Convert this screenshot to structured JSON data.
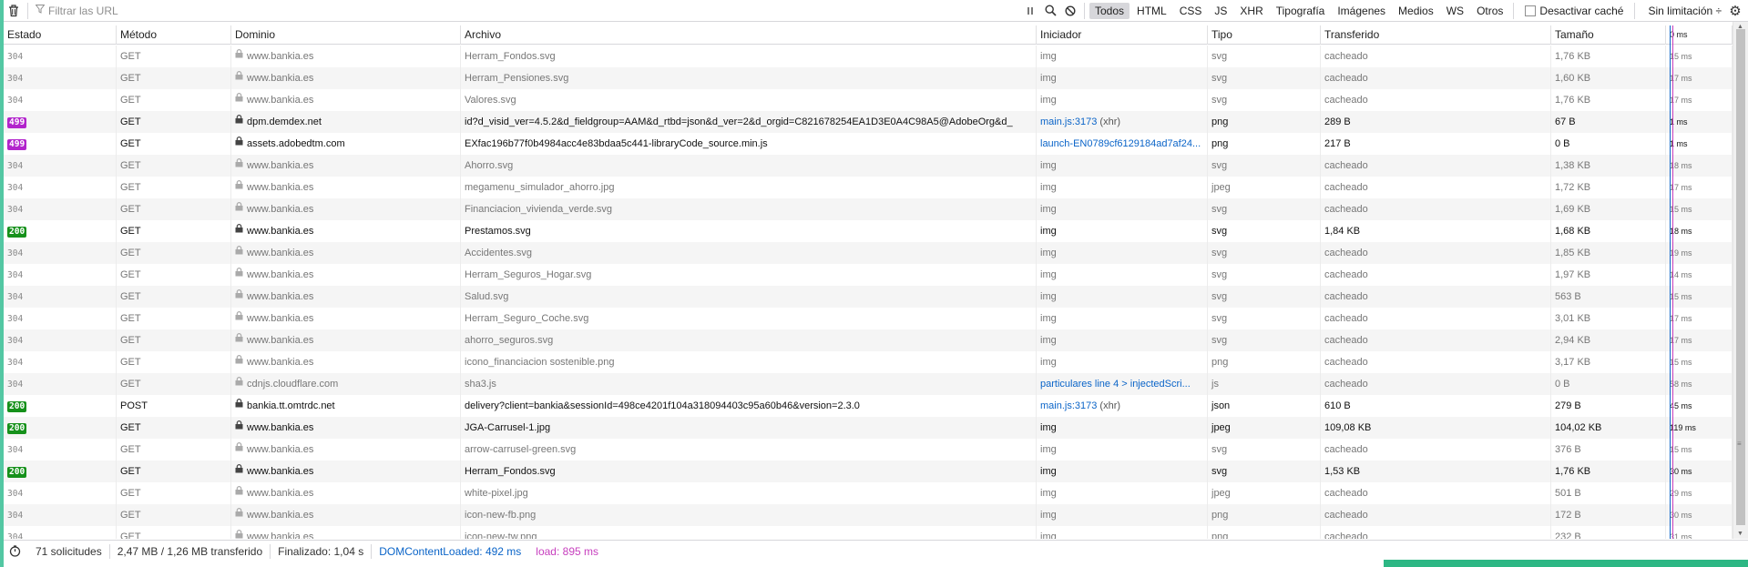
{
  "toolbar": {
    "filter_placeholder": "Filtrar las URL",
    "types": [
      "Todos",
      "HTML",
      "CSS",
      "JS",
      "XHR",
      "Tipografía",
      "Imágenes",
      "Medios",
      "WS",
      "Otros"
    ],
    "active_type": "Todos",
    "disable_cache_label": "Desactivar caché",
    "throttle_label": "Sin limitación ÷"
  },
  "columns": [
    "Estado",
    "Método",
    "Dominio",
    "Archivo",
    "Iniciador",
    "Tipo",
    "Transferido",
    "Tamaño",
    "0 ms"
  ],
  "colors": {
    "badge_200": "#16911b",
    "badge_499": "#b224cc",
    "accent": "#53c7a3",
    "link": "#0a64c8",
    "load": "#c73fbe"
  },
  "requests": [
    {
      "status": "304",
      "method": "GET",
      "domain": "www.bankia.es",
      "file": "Herram_Fondos.svg",
      "initiator": "img",
      "initiator_suffix": "",
      "type": "svg",
      "transferred": "cacheado",
      "size": "1,76 KB",
      "time": "15 ms",
      "fresh": false
    },
    {
      "status": "304",
      "method": "GET",
      "domain": "www.bankia.es",
      "file": "Herram_Pensiones.svg",
      "initiator": "img",
      "initiator_suffix": "",
      "type": "svg",
      "transferred": "cacheado",
      "size": "1,60 KB",
      "time": "17 ms",
      "fresh": false
    },
    {
      "status": "304",
      "method": "GET",
      "domain": "www.bankia.es",
      "file": "Valores.svg",
      "initiator": "img",
      "initiator_suffix": "",
      "type": "svg",
      "transferred": "cacheado",
      "size": "1,76 KB",
      "time": "17 ms",
      "fresh": false
    },
    {
      "status": "499",
      "method": "GET",
      "domain": "dpm.demdex.net",
      "file": "id?d_visid_ver=4.5.2&d_fieldgroup=AAM&d_rtbd=json&d_ver=2&d_orgid=C821678254EA1D3E0A4C98A5@AdobeOrg&d_",
      "initiator": "main.js:3173",
      "initiator_suffix": " (xhr)",
      "type": "png",
      "transferred": "289 B",
      "size": "67 B",
      "time": "1 ms",
      "fresh": true
    },
    {
      "status": "499",
      "method": "GET",
      "domain": "assets.adobedtm.com",
      "file": "EXfac196b77f0b4984acc4e83bdaa5c441-libraryCode_source.min.js",
      "initiator": "launch-EN0789cf6129184ad7af24...",
      "initiator_suffix": "",
      "type": "png",
      "transferred": "217 B",
      "size": "0 B",
      "time": "1 ms",
      "fresh": true
    },
    {
      "status": "304",
      "method": "GET",
      "domain": "www.bankia.es",
      "file": "Ahorro.svg",
      "initiator": "img",
      "initiator_suffix": "",
      "type": "svg",
      "transferred": "cacheado",
      "size": "1,38 KB",
      "time": "18 ms",
      "fresh": false
    },
    {
      "status": "304",
      "method": "GET",
      "domain": "www.bankia.es",
      "file": "megamenu_simulador_ahorro.jpg",
      "initiator": "img",
      "initiator_suffix": "",
      "type": "jpeg",
      "transferred": "cacheado",
      "size": "1,72 KB",
      "time": "17 ms",
      "fresh": false
    },
    {
      "status": "304",
      "method": "GET",
      "domain": "www.bankia.es",
      "file": "Financiacion_vivienda_verde.svg",
      "initiator": "img",
      "initiator_suffix": "",
      "type": "svg",
      "transferred": "cacheado",
      "size": "1,69 KB",
      "time": "15 ms",
      "fresh": false
    },
    {
      "status": "200",
      "method": "GET",
      "domain": "www.bankia.es",
      "file": "Prestamos.svg",
      "initiator": "img",
      "initiator_suffix": "",
      "type": "svg",
      "transferred": "1,84 KB",
      "size": "1,68 KB",
      "time": "18 ms",
      "fresh": true
    },
    {
      "status": "304",
      "method": "GET",
      "domain": "www.bankia.es",
      "file": "Accidentes.svg",
      "initiator": "img",
      "initiator_suffix": "",
      "type": "svg",
      "transferred": "cacheado",
      "size": "1,85 KB",
      "time": "19 ms",
      "fresh": false
    },
    {
      "status": "304",
      "method": "GET",
      "domain": "www.bankia.es",
      "file": "Herram_Seguros_Hogar.svg",
      "initiator": "img",
      "initiator_suffix": "",
      "type": "svg",
      "transferred": "cacheado",
      "size": "1,97 KB",
      "time": "14 ms",
      "fresh": false
    },
    {
      "status": "304",
      "method": "GET",
      "domain": "www.bankia.es",
      "file": "Salud.svg",
      "initiator": "img",
      "initiator_suffix": "",
      "type": "svg",
      "transferred": "cacheado",
      "size": "563 B",
      "time": "15 ms",
      "fresh": false
    },
    {
      "status": "304",
      "method": "GET",
      "domain": "www.bankia.es",
      "file": "Herram_Seguro_Coche.svg",
      "initiator": "img",
      "initiator_suffix": "",
      "type": "svg",
      "transferred": "cacheado",
      "size": "3,01 KB",
      "time": "17 ms",
      "fresh": false
    },
    {
      "status": "304",
      "method": "GET",
      "domain": "www.bankia.es",
      "file": "ahorro_seguros.svg",
      "initiator": "img",
      "initiator_suffix": "",
      "type": "svg",
      "transferred": "cacheado",
      "size": "2,94 KB",
      "time": "17 ms",
      "fresh": false
    },
    {
      "status": "304",
      "method": "GET",
      "domain": "www.bankia.es",
      "file": "icono_financiacion sostenible.png",
      "initiator": "img",
      "initiator_suffix": "",
      "type": "png",
      "transferred": "cacheado",
      "size": "3,17 KB",
      "time": "15 ms",
      "fresh": false
    },
    {
      "status": "304",
      "method": "GET",
      "domain": "cdnjs.cloudflare.com",
      "file": "sha3.js",
      "initiator": "particulares line 4 > injectedScri...",
      "initiator_suffix": "",
      "type": "js",
      "transferred": "cacheado",
      "size": "0 B",
      "time": "58 ms",
      "fresh": false
    },
    {
      "status": "200",
      "method": "POST",
      "domain": "bankia.tt.omtrdc.net",
      "file": "delivery?client=bankia&sessionId=498ce4201f104a318094403c95a60b46&version=2.3.0",
      "initiator": "main.js:3173",
      "initiator_suffix": " (xhr)",
      "type": "json",
      "transferred": "610 B",
      "size": "279 B",
      "time": "45 ms",
      "fresh": true
    },
    {
      "status": "200",
      "method": "GET",
      "domain": "www.bankia.es",
      "file": "JGA-Carrusel-1.jpg",
      "initiator": "img",
      "initiator_suffix": "",
      "type": "jpeg",
      "transferred": "109,08 KB",
      "size": "104,02 KB",
      "time": "119 ms",
      "fresh": true
    },
    {
      "status": "304",
      "method": "GET",
      "domain": "www.bankia.es",
      "file": "arrow-carrusel-green.svg",
      "initiator": "img",
      "initiator_suffix": "",
      "type": "svg",
      "transferred": "cacheado",
      "size": "376 B",
      "time": "15 ms",
      "fresh": false
    },
    {
      "status": "200",
      "method": "GET",
      "domain": "www.bankia.es",
      "file": "Herram_Fondos.svg",
      "initiator": "img",
      "initiator_suffix": "",
      "type": "svg",
      "transferred": "1,53 KB",
      "size": "1,76 KB",
      "time": "30 ms",
      "fresh": true
    },
    {
      "status": "304",
      "method": "GET",
      "domain": "www.bankia.es",
      "file": "white-pixel.jpg",
      "initiator": "img",
      "initiator_suffix": "",
      "type": "jpeg",
      "transferred": "cacheado",
      "size": "501 B",
      "time": "29 ms",
      "fresh": false
    },
    {
      "status": "304",
      "method": "GET",
      "domain": "www.bankia.es",
      "file": "icon-new-fb.png",
      "initiator": "img",
      "initiator_suffix": "",
      "type": "png",
      "transferred": "cacheado",
      "size": "172 B",
      "time": "30 ms",
      "fresh": false
    },
    {
      "status": "304",
      "method": "GET",
      "domain": "www.bankia.es",
      "file": "icon-new-tw.png",
      "initiator": "img",
      "initiator_suffix": "",
      "type": "png",
      "transferred": "cacheado",
      "size": "232 B",
      "time": "31 ms",
      "fresh": false
    }
  ],
  "statusbar": {
    "requests": "71 solicitudes",
    "transferred": "2,47 MB / 1,26 MB transferido",
    "finished": "Finalizado: 1,04 s",
    "dom_loaded": "DOMContentLoaded: 492 ms",
    "load": "load: 895 ms"
  }
}
